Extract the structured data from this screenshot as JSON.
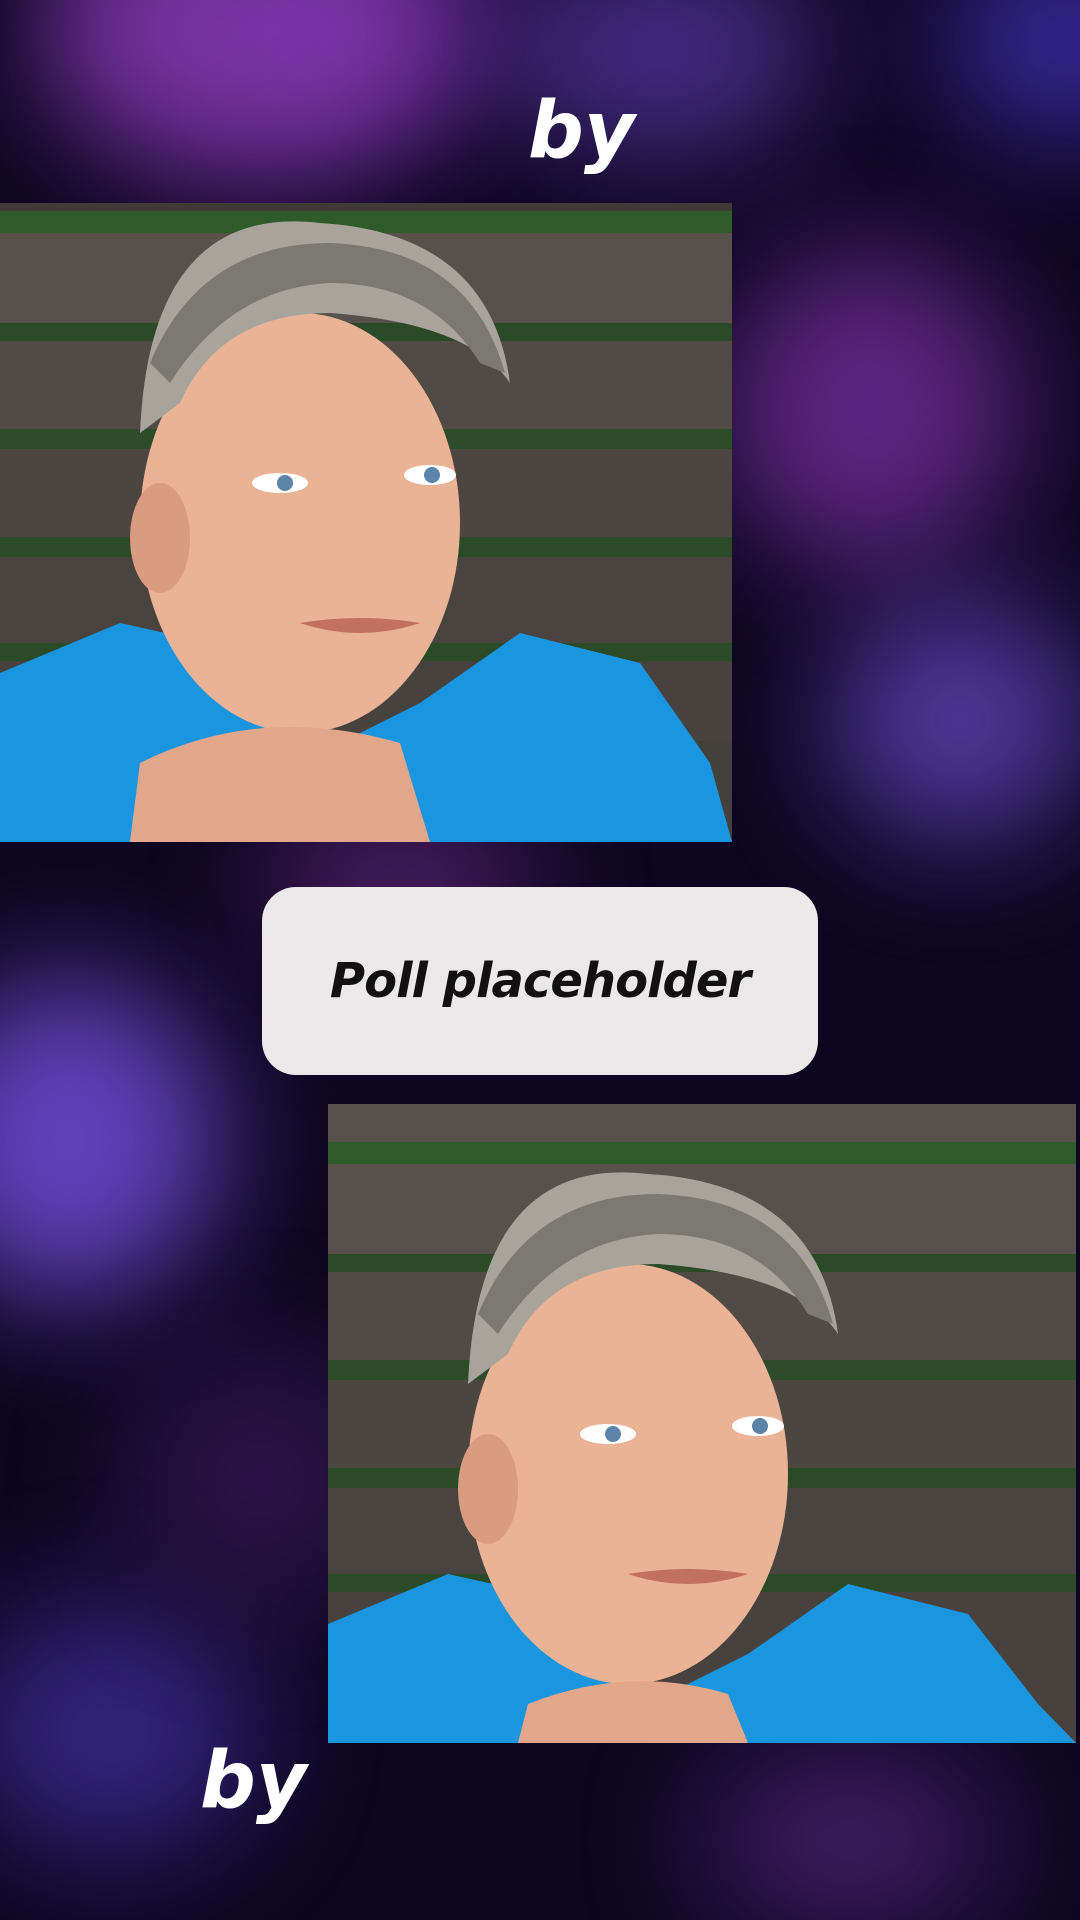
{
  "header": {
    "by_label": "by"
  },
  "footer": {
    "by_label": "by"
  },
  "poll": {
    "placeholder_label": "Poll placeholder"
  },
  "photos": [
    {
      "icon": "portrait-photo"
    },
    {
      "icon": "portrait-photo"
    }
  ],
  "colors": {
    "background": "#0d0620",
    "accent_purple": "#8a3ab8",
    "poll_bg": "#ece8ea",
    "shirt_blue": "#1a96e0"
  }
}
